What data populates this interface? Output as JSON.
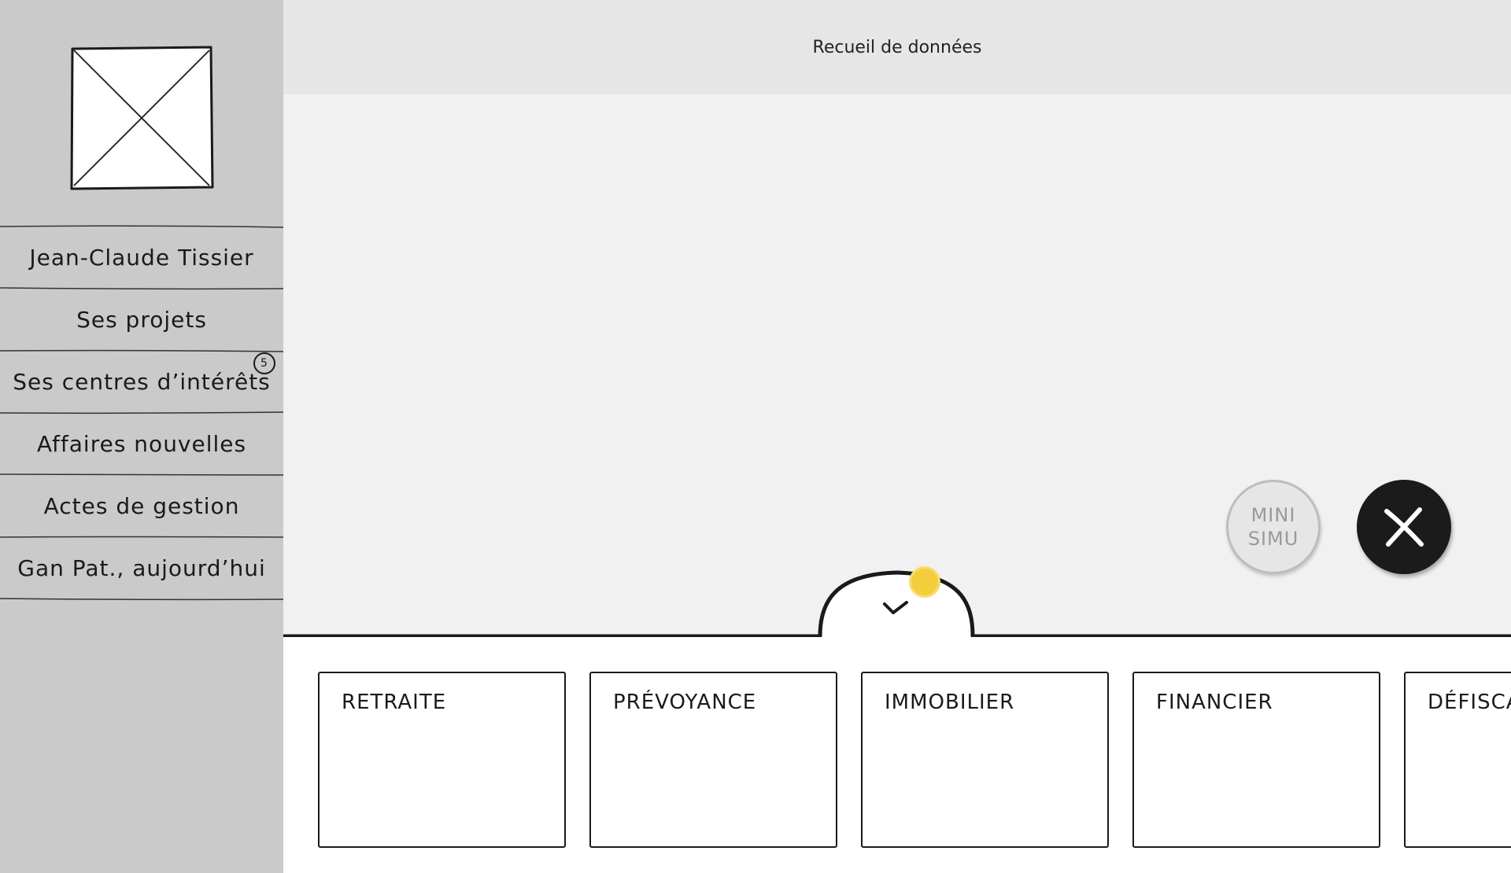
{
  "header": {
    "title": "Recueil de données"
  },
  "sidebar": {
    "logo_icon": "image-placeholder-icon",
    "items": [
      {
        "label": "Jean-Claude Tissier"
      },
      {
        "label": "Ses projets"
      },
      {
        "label": "Ses centres d’intérêts",
        "badge": "5"
      },
      {
        "label": "Affaires nouvelles"
      },
      {
        "label": "Actes de gestion"
      },
      {
        "label": "Gan Pat., aujourd’hui"
      }
    ]
  },
  "actions": {
    "mini_simu_line1": "MINI",
    "mini_simu_line2": "SIMU",
    "close_icon": "close-icon"
  },
  "drawer": {
    "handle_icon": "check-icon",
    "indicator_color": "#f3cd3c",
    "cards": [
      {
        "title": "RETRAITE"
      },
      {
        "title": "PRÉVOYANCE"
      },
      {
        "title": "IMMOBILIER"
      },
      {
        "title": "FINANCIER"
      },
      {
        "title": "DÉFISCA"
      }
    ]
  },
  "colors": {
    "sidebar_bg": "#cacaca",
    "header_bg": "#e6e6e6",
    "canvas_bg": "#f1f1f1",
    "ink": "#1a1a1a",
    "accent_yellow": "#f3cd3c"
  }
}
